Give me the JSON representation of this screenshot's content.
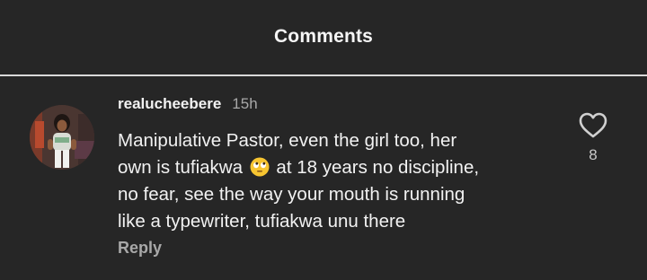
{
  "header": {
    "title": "Comments"
  },
  "comment": {
    "username": "realucheebere",
    "time": "15h",
    "text_lines": [
      "Manipulative Pastor, even the girl too, her",
      "own is tufiakwa",
      "at 18 years no discipline,",
      "no fear, see the way your mouth is running",
      "like a typewriter, tufiakwa unu there"
    ],
    "emoji": "eye-roll-emoji",
    "reply_label": "Reply",
    "like_icon": "heart-outline-icon",
    "like_count": "8"
  },
  "colors": {
    "background": "#262626",
    "divider": "#d9d9d9",
    "muted_text": "#a8a8a8",
    "primary_text": "#f2f2f2"
  }
}
